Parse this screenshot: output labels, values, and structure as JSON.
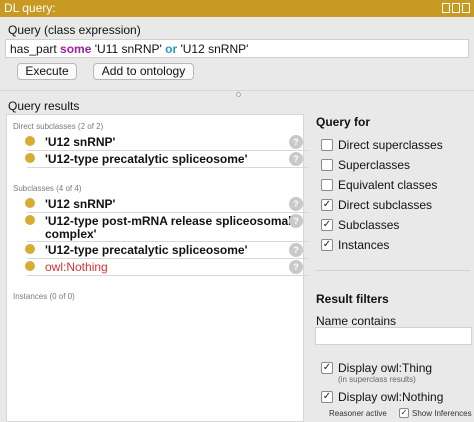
{
  "window": {
    "title": "DL query:"
  },
  "query": {
    "label": "Query (class expression)",
    "expr": {
      "p1": "has_part ",
      "kw1": "some",
      "p2": " 'U11 snRNP' ",
      "kw2": "or",
      "p3": " 'U12 snRNP'"
    }
  },
  "buttons": {
    "execute": "Execute",
    "add": "Add to ontology"
  },
  "results": {
    "label": "Query results",
    "direct_subclasses": {
      "heading": "Direct subclasses (2 of 2)",
      "items": [
        "'U12 snRNP'",
        "'U12-type precatalytic spliceosome'"
      ]
    },
    "subclasses": {
      "heading": "Subclasses (4 of 4)",
      "items": [
        "'U12 snRNP'",
        "'U12-type post-mRNA release spliceosomal",
        "complex'",
        "'U12-type precatalytic spliceosome'",
        "owl:Nothing"
      ]
    },
    "instances": {
      "heading": "Instances (0 of 0)"
    },
    "help_glyph": "?"
  },
  "query_for": {
    "heading": "Query for",
    "options": [
      {
        "label": "Direct superclasses",
        "checked": false
      },
      {
        "label": "Superclasses",
        "checked": false
      },
      {
        "label": "Equivalent classes",
        "checked": false
      },
      {
        "label": "Direct subclasses",
        "checked": true
      },
      {
        "label": "Subclasses",
        "checked": true
      },
      {
        "label": "Instances",
        "checked": true
      }
    ]
  },
  "filters": {
    "heading": "Result filters",
    "name_contains": "Name contains",
    "display_thing": {
      "label": "Display owl:Thing",
      "note": "(in superclass results)",
      "checked": true
    },
    "display_nothing": {
      "label": "Display owl:Nothing",
      "checked": true
    }
  },
  "status": {
    "reasoner": "Reasoner active",
    "show_inferences": "Show Inferences",
    "show_inferences_checked": true
  },
  "check_glyph": "✓",
  "colors": {
    "title_bar": "#c89a24",
    "some_kw": "#a020a0",
    "or_kw": "#2a9ac6",
    "entity_dot": "#d8ab32",
    "nothing_text": "#d63333"
  }
}
